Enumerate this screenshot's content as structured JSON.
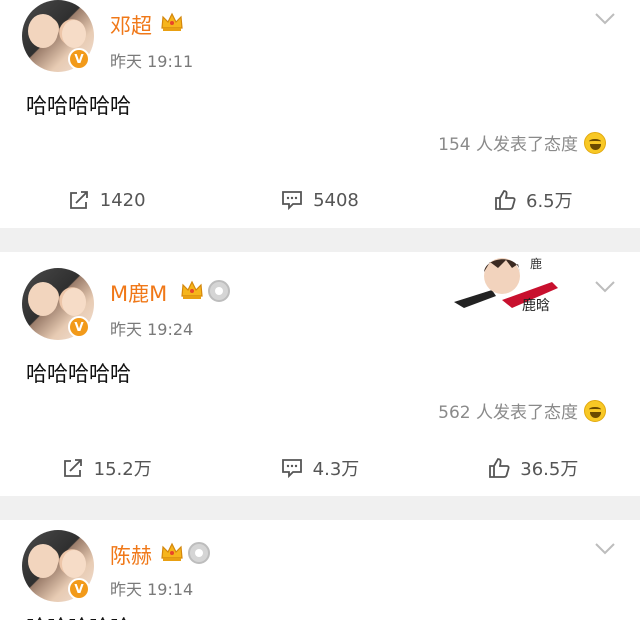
{
  "posts": [
    {
      "name": "邓超",
      "time": "昨天 19:11",
      "content": "哈哈哈哈哈",
      "reactions": "154 人发表了态度",
      "actions": {
        "repost": "1420",
        "comment": "5408",
        "like": "6.5万"
      }
    },
    {
      "name": "M鹿M",
      "time": "昨天 19:24",
      "content": "哈哈哈哈哈",
      "reactions": "562 人发表了态度",
      "actions": {
        "repost": "15.2万",
        "comment": "4.3万",
        "like": "36.5万"
      }
    },
    {
      "name": "陈赫",
      "time": "昨天 19:14",
      "content": "哈哈哈哈哈"
    }
  ],
  "colors": {
    "name": "#f07818",
    "badge": "#f29a1a",
    "divider": "#f0f0f0"
  },
  "icons": [
    "chevron-down-icon",
    "repost-icon",
    "comment-icon",
    "like-icon",
    "crown-icon",
    "medal-icon",
    "laugh-emoji-icon",
    "verified-badge-icon"
  ]
}
